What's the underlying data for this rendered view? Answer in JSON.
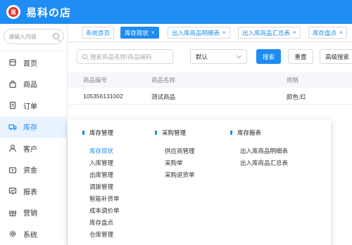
{
  "app": {
    "logo_text": "易",
    "title": "易科の店"
  },
  "sidebar": {
    "search_placeholder": "请输入内容",
    "items": [
      {
        "label": "首页",
        "icon": "home-icon",
        "active": false
      },
      {
        "label": "商品",
        "icon": "bag-icon",
        "active": false
      },
      {
        "label": "订单",
        "icon": "document-icon",
        "active": false
      },
      {
        "label": "库存",
        "icon": "truck-icon",
        "active": true
      },
      {
        "label": "客户",
        "icon": "user-icon",
        "active": false
      },
      {
        "label": "资金",
        "icon": "wallet-icon",
        "active": false
      },
      {
        "label": "报表",
        "icon": "chart-icon",
        "active": false
      },
      {
        "label": "营销",
        "icon": "gift-icon",
        "active": false
      },
      {
        "label": "系统",
        "icon": "gear-icon",
        "active": false
      }
    ]
  },
  "tabs": [
    {
      "label": "系统首页",
      "closable": false,
      "active": false
    },
    {
      "label": "库存现状",
      "closable": true,
      "active": true
    },
    {
      "label": "出入库商品明细表",
      "closable": true,
      "active": false
    },
    {
      "label": "出入库商品汇总表",
      "closable": true,
      "active": false
    },
    {
      "label": "库存盘点",
      "closable": true,
      "active": false
    }
  ],
  "toolbar": {
    "search_placeholder": "搜索商品名称/商品编码",
    "select_value": "默认",
    "search_button": "搜索",
    "reset_button": "重置",
    "advanced_button": "高级搜索"
  },
  "table": {
    "columns": [
      "商品编号",
      "商品名称",
      "规格"
    ],
    "rows": [
      {
        "code": "105356131002",
        "name": "测试商品",
        "spec": "颜色:红"
      }
    ]
  },
  "dropdown": {
    "inventory": {
      "title": "库存管理",
      "links": [
        "库存现状",
        "入库管理",
        "出库管理",
        "调拨管理",
        "智能补货单",
        "成本调价单",
        "库存盘点",
        "仓库管理"
      ]
    },
    "purchase": {
      "title": "采购管理",
      "links": [
        "供应商管理",
        "采购单",
        "采购退货单"
      ]
    },
    "reports": {
      "title": "库存报表",
      "links": [
        "出入库商品明细表",
        "出入库商品汇总表"
      ]
    }
  },
  "colors": {
    "accent": "#1e8cf0",
    "logo_red": "#e0322a"
  }
}
